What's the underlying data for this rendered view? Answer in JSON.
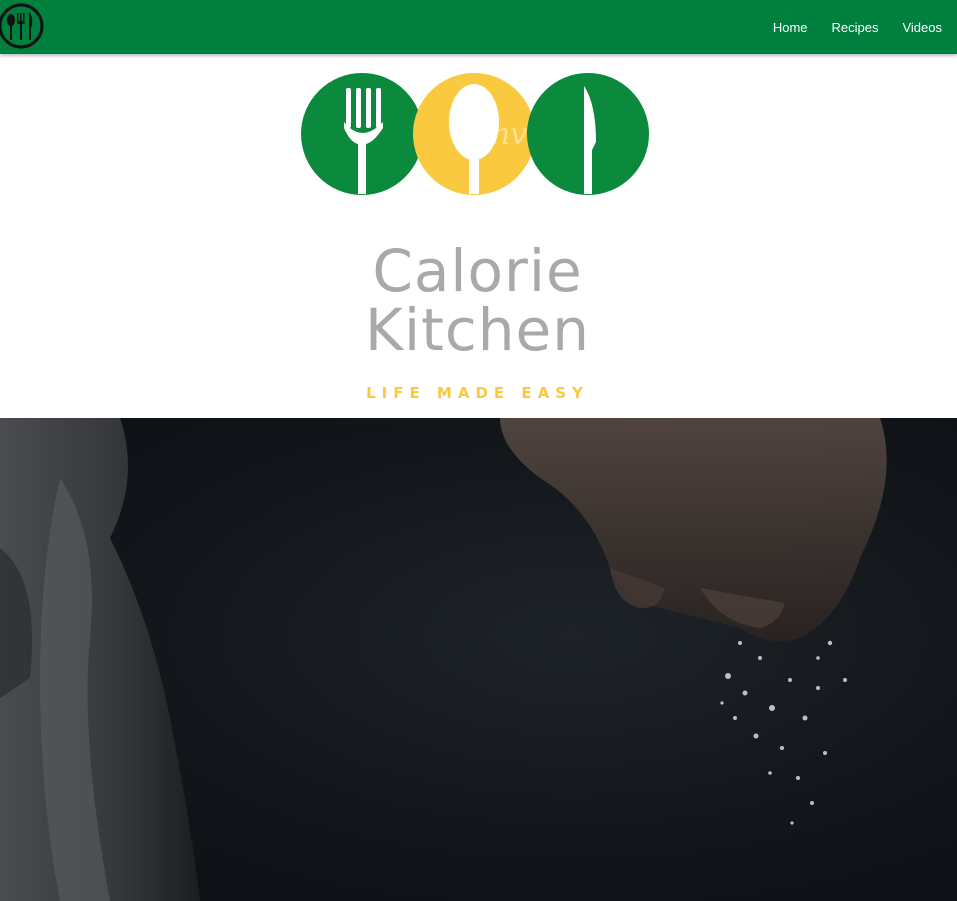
{
  "nav": {
    "logo_icon": "fork-spoon-knife-icon",
    "links": [
      "Home",
      "Recipes",
      "Videos"
    ],
    "bg_color": "#00803f"
  },
  "hero": {
    "brand_line1": "Calorie",
    "brand_line2": "Kitchen",
    "tagline": "LIFE MADE EASY",
    "circle_colors": [
      "#0b8a3e",
      "#f9c940",
      "#0b8a3e"
    ],
    "watermark": "Canva"
  },
  "video": {
    "description_icon": "chef-sprinkling-salt-image"
  }
}
